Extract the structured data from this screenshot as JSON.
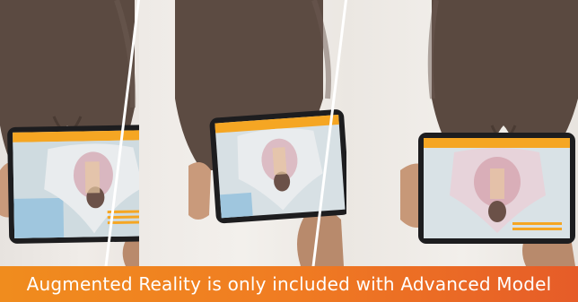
{
  "banner": {
    "text": "Augmented Reality is only included with Advanced Model"
  },
  "colors": {
    "banner_start": "#f08c1e",
    "banner_end": "#e65c28",
    "ar_header": "#f5a623",
    "mannequin_skin": "#5a4a42"
  },
  "panels": [
    {
      "name": "tablet-view-left"
    },
    {
      "name": "tablet-view-center"
    },
    {
      "name": "tablet-view-right"
    }
  ]
}
